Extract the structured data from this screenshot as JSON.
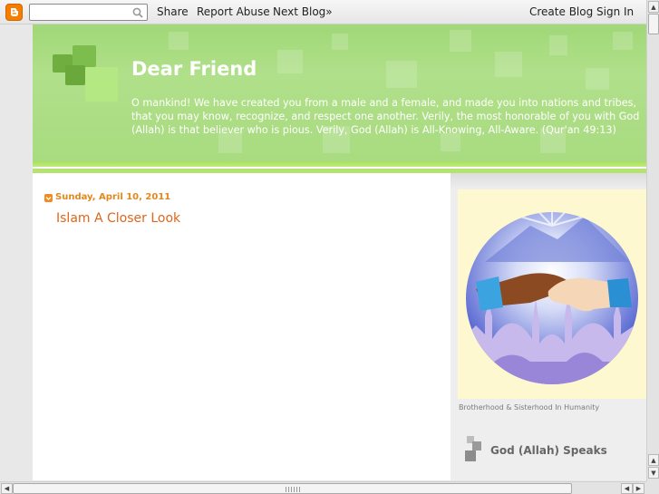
{
  "navbar": {
    "search_placeholder": "",
    "links": {
      "share": "Share",
      "report_abuse": "Report Abuse",
      "next_blog": "Next Blog»",
      "create_blog": "Create Blog",
      "sign_in": "Sign In"
    }
  },
  "header": {
    "title": "Dear Friend",
    "description": "O mankind! We have created you from a male and a female, and made you into nations and tribes, that you may know, recognize, and respect one another. Verily, the most honorable of you with God (Allah) is that believer who is pious. Verily, God (Allah) is All-Knowing, All-Aware. (Qur'an 49:13)"
  },
  "main": {
    "date_header": "Sunday, April 10, 2011",
    "post_title": "Islam A Closer Look"
  },
  "sidebar": {
    "image_caption": "Brotherhood & Sisterhood In Humanity",
    "widget_title": "God (Allah) Speaks"
  },
  "colors": {
    "header_green": "#95d364",
    "date_orange": "#e2881d",
    "post_title_orange": "#e0651a",
    "blogger_orange": "#f57d00"
  },
  "icons": {
    "logo": "blogger-icon",
    "search": "search-icon",
    "date": "date-bullet-icon",
    "widget": "widget-squares-icon"
  }
}
